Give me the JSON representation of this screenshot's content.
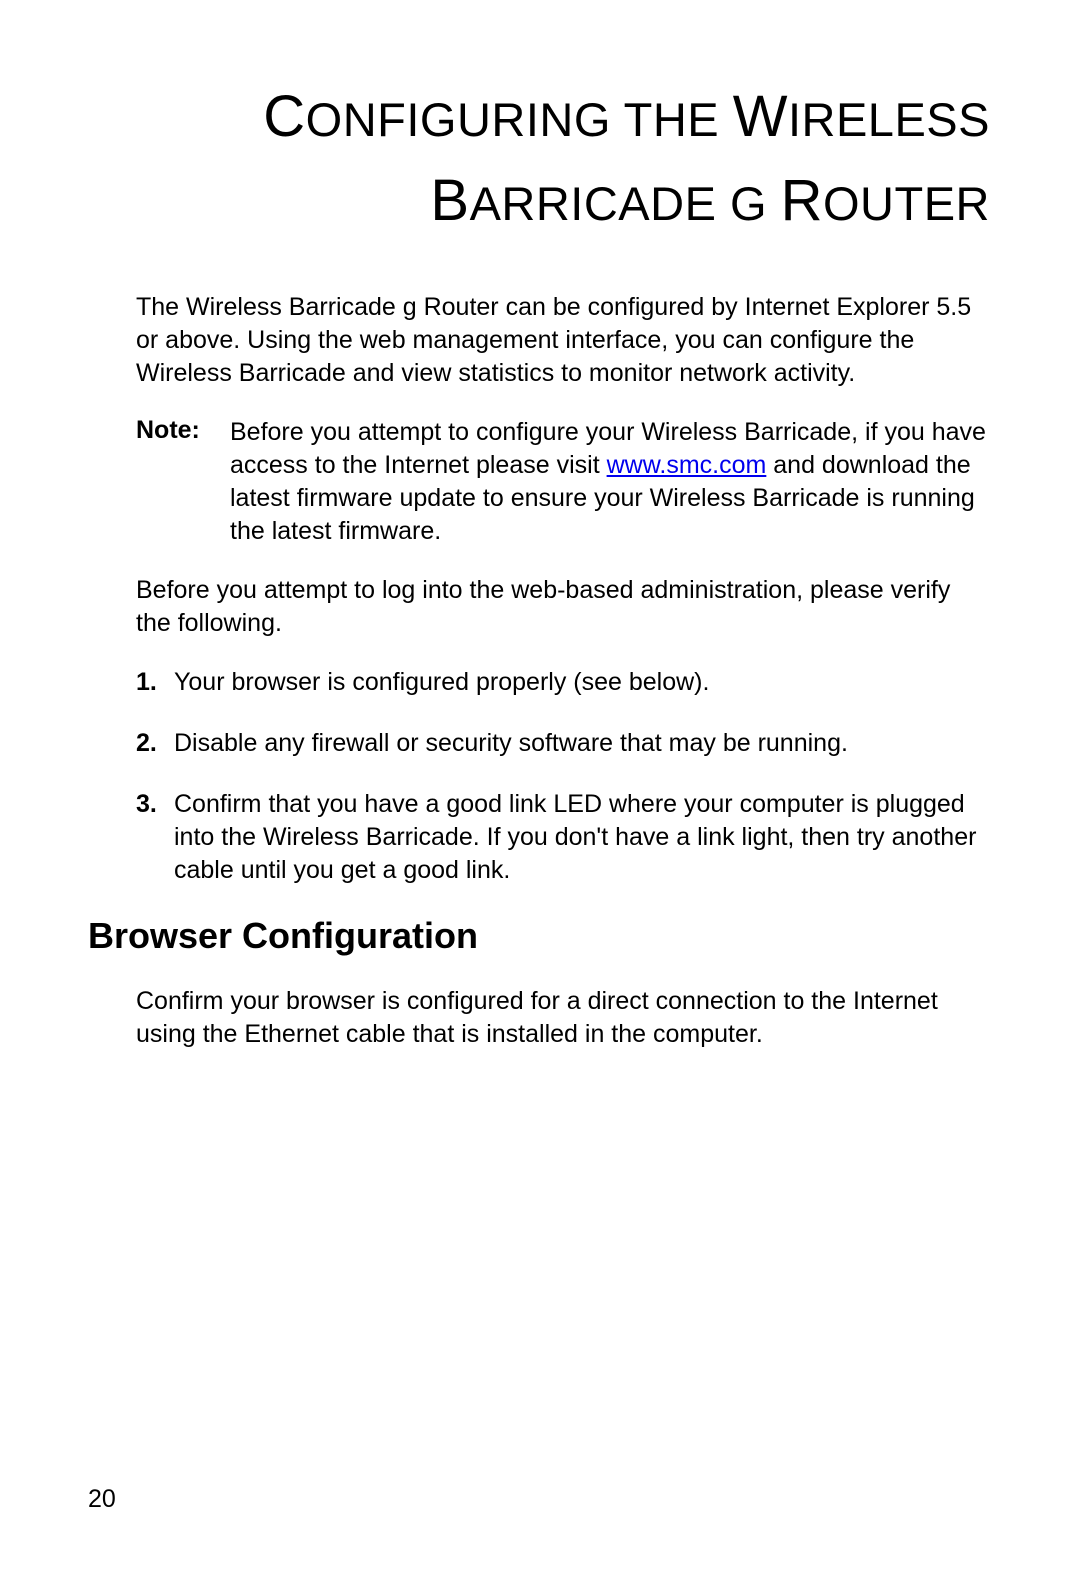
{
  "title_line1_part1": "C",
  "title_line1_part2": "onfiguring the ",
  "title_line1_part3": "W",
  "title_line1_part4": "ireless",
  "title_line2_part1": "B",
  "title_line2_part2": "arricade g ",
  "title_line2_part3": "R",
  "title_line2_part4": "outer",
  "intro": "The Wireless Barricade g Router can be configured by Internet Explorer 5.5 or above. Using the web management interface, you can configure the Wireless Barricade and view statistics to monitor network activity.",
  "note_label": "Note:",
  "note_before_link": "Before you attempt to configure your Wireless Barricade, if you have access to the Internet please visit ",
  "note_link": "www.smc.com",
  "note_after_link": " and download the latest firmware update to ensure your Wireless Barricade is running the latest firmware.",
  "before_list": "Before you attempt to log into the web-based administration, please verify the following.",
  "list": [
    {
      "num": "1.",
      "text": "Your browser is configured properly (see below)."
    },
    {
      "num": "2.",
      "text": "Disable any firewall or security software that may be running."
    },
    {
      "num": "3.",
      "text": "Confirm that you have a good link LED where your computer is plugged into the Wireless Barricade. If you don't have a link light, then try another cable until you get a good link."
    }
  ],
  "section_heading": "Browser Configuration",
  "section_body": "Confirm your browser is configured for a direct connection to the Internet using the Ethernet cable that is installed in the computer.",
  "page_number": "20"
}
